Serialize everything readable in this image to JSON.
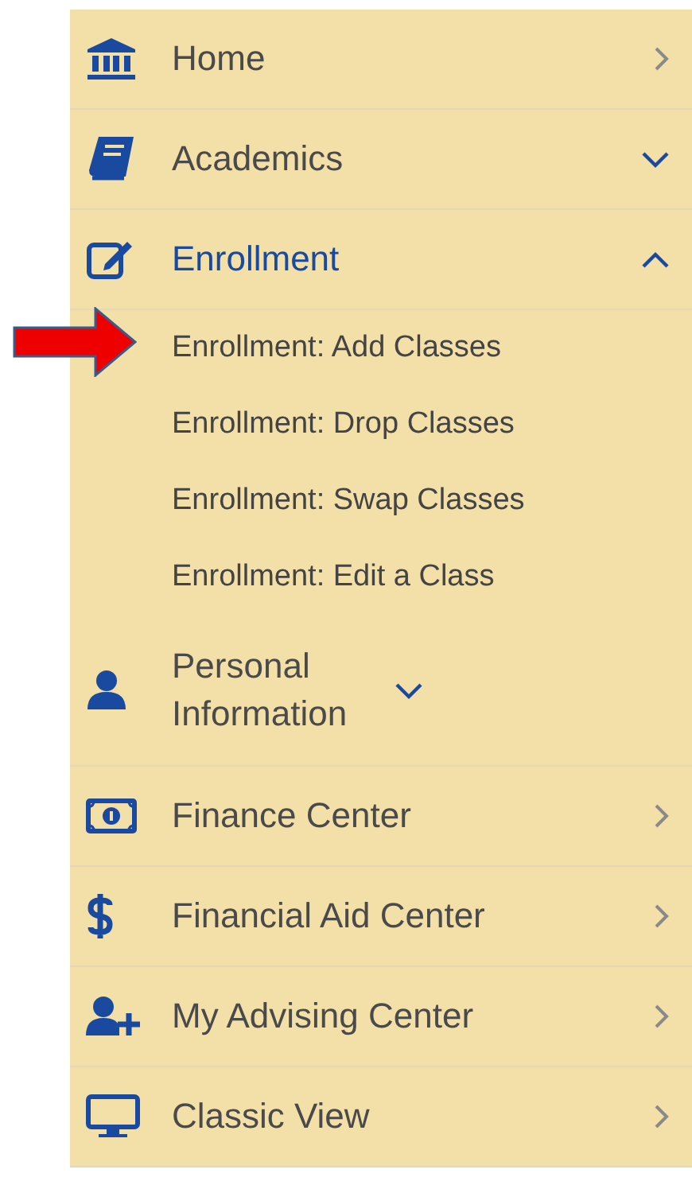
{
  "menu": [
    {
      "label": "Home",
      "kind": "link"
    },
    {
      "label": "Academics",
      "kind": "group",
      "expanded": false
    },
    {
      "label": "Enrollment",
      "kind": "group",
      "expanded": true,
      "children": [
        {
          "label": "Enrollment: Add Classes",
          "marked": true
        },
        {
          "label": "Enrollment: Drop Classes",
          "marked": false
        },
        {
          "label": "Enrollment: Swap Classes",
          "marked": false
        },
        {
          "label": "Enrollment: Edit a Class",
          "marked": false
        }
      ]
    },
    {
      "label": "Personal Information",
      "kind": "group",
      "expanded": false
    },
    {
      "label": "Finance Center",
      "kind": "link"
    },
    {
      "label": "Financial Aid Center",
      "kind": "link"
    },
    {
      "label": "My Advising Center",
      "kind": "link"
    },
    {
      "label": "Classic View",
      "kind": "link"
    }
  ]
}
